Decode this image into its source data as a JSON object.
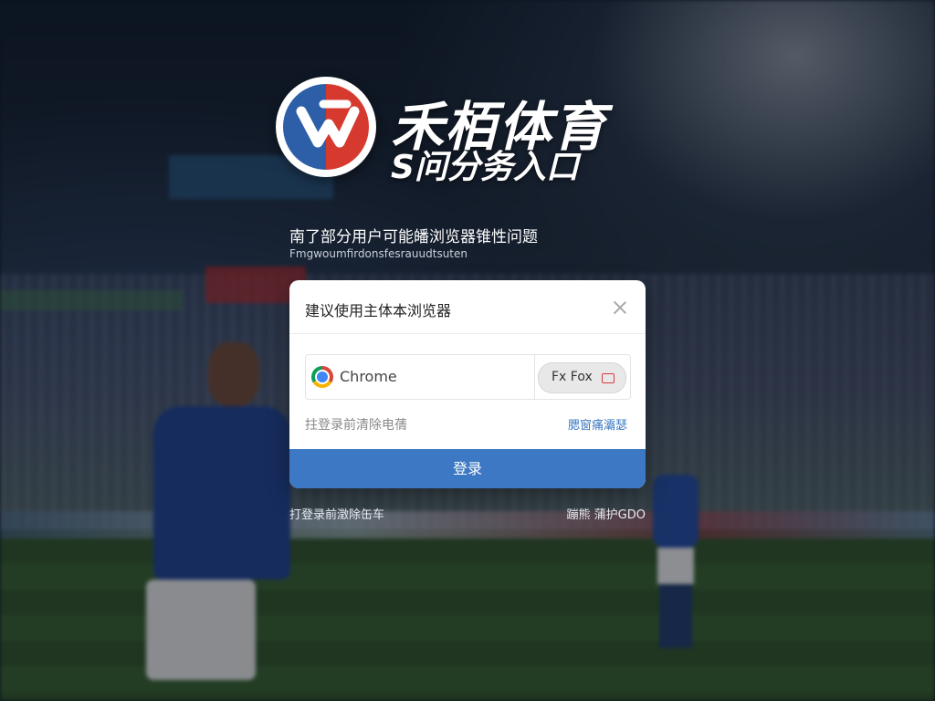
{
  "brand": {
    "name": "禾栢体育",
    "subtitle": "S问分务入口"
  },
  "notice": {
    "title": "南了部分用户可能皤浏览器锥性问题",
    "subtitle": "Fmgwoumfirdonsfesrauudtsuten"
  },
  "dialog": {
    "title": "建议使用主体本浏览器",
    "close_icon": "close-icon",
    "browsers": {
      "chrome_label": "Chrome",
      "chrome_icon": "chrome-icon",
      "firefox_label": "Fx Fox",
      "firefox_icon": "firefox-icon"
    },
    "clear_hint": "拄登录前清除电蒨",
    "help_link": "腮窗痛灞瑟",
    "login_label": "登录"
  },
  "footer": {
    "left": "打登录前澂除缶车",
    "right": "蹦熊 蒲护GDO"
  },
  "colors": {
    "accent": "#3c78c3",
    "logo_blue": "#2d5fa8",
    "logo_red": "#d63a2f"
  }
}
